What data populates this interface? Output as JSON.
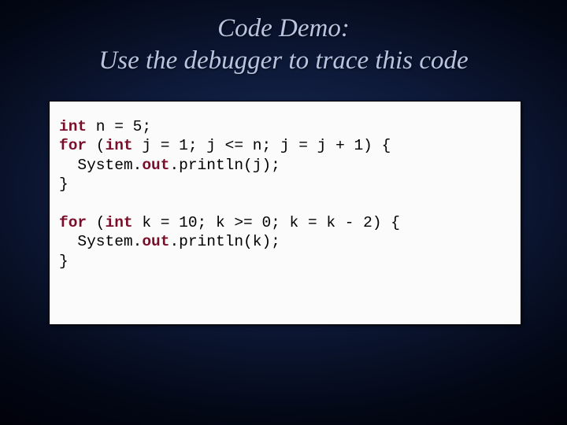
{
  "title_line1": "Code Demo:",
  "title_line2": "Use the debugger to trace this code",
  "code": {
    "kw_int": "int",
    "kw_for": "for",
    "kw_out": "out",
    "l1a": " n = 5;",
    "l2a": " (",
    "l2b": " j = 1; j <= n; j = j + 1) {",
    "l3a": "  System.",
    "l3b": ".println(j);",
    "l4": "}",
    "l5a": " (",
    "l5b": " k = 10; k >= 0; k = k - 2) {",
    "l6a": "  System.",
    "l6b": ".println(k);",
    "l7": "}"
  }
}
